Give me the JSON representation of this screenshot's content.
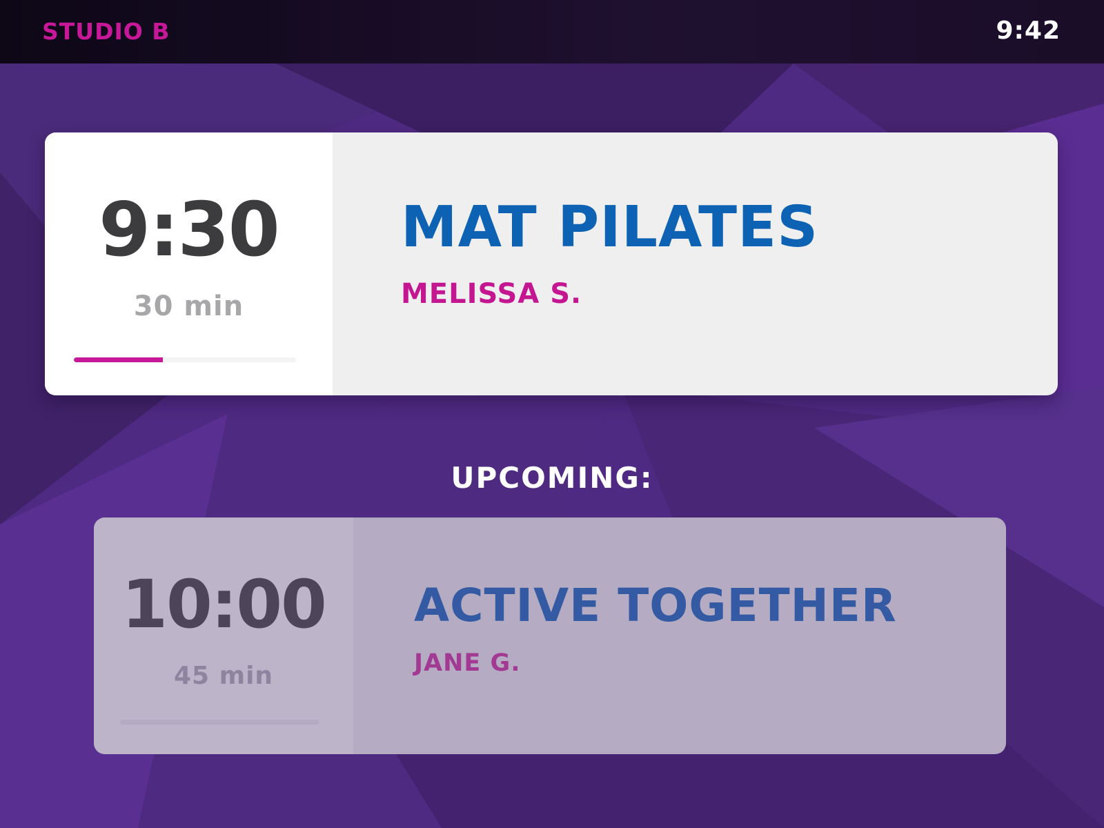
{
  "header": {
    "studio": "STUDIO B",
    "clock": "9:42"
  },
  "current_class": {
    "start_time": "9:30",
    "duration": "30 min",
    "name": "MAT PILATES",
    "instructor": "MELISSA S.",
    "progress": 0.4
  },
  "upcoming": {
    "label": "UPCOMING:",
    "classes": [
      {
        "start_time": "10:00",
        "duration": "45 min",
        "name": "ACTIVE TOGETHER",
        "instructor": "JANE G.",
        "progress": 0
      }
    ]
  },
  "colors": {
    "accent": "#c8189a",
    "title_blue": "#0d62b4",
    "background_purple": "#4f2a82"
  }
}
